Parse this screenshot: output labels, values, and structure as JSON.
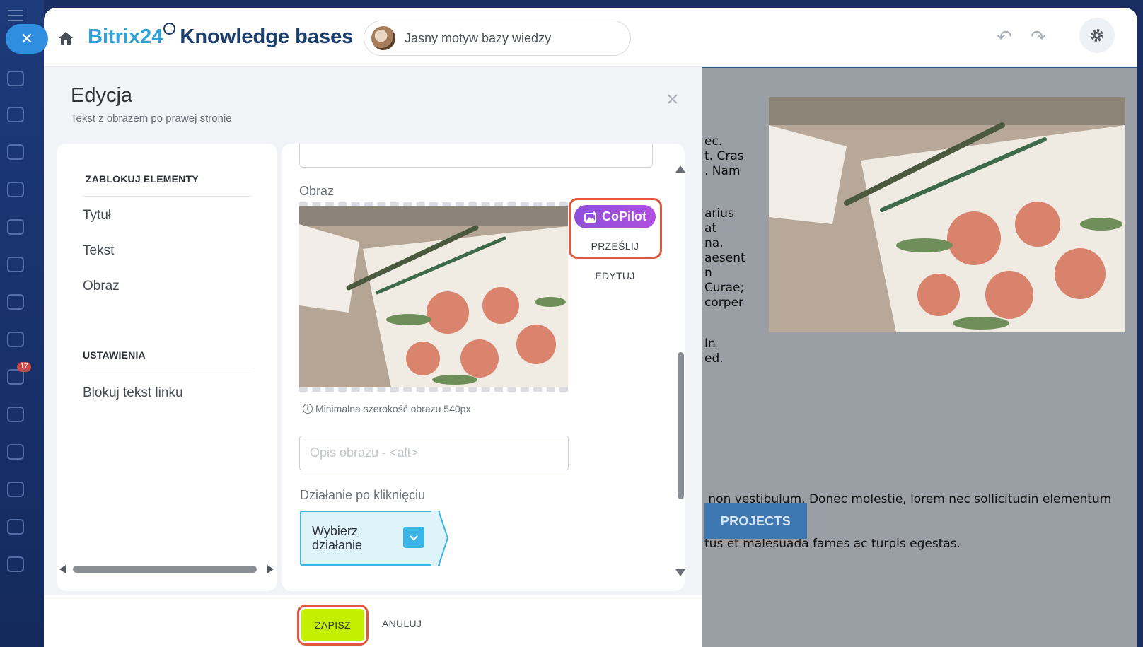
{
  "header": {
    "logo_brand": "Bitrix24",
    "logo_title": "Knowledge bases",
    "theme_name": "Jasny motyw bazy wiedzy"
  },
  "editor": {
    "title": "Edycja",
    "subtitle": "Tekst z obrazem po prawej stronie"
  },
  "nav": {
    "lock_section": "ZABLOKUJ ELEMENTY",
    "lock_items": [
      {
        "label": "Tytuł"
      },
      {
        "label": "Tekst"
      },
      {
        "label": "Obraz"
      }
    ],
    "settings_section": "USTAWIENIA",
    "settings_items": [
      {
        "label": "Blokuj tekst linku"
      }
    ]
  },
  "form": {
    "image_label": "Obraz",
    "copilot_label": "CoPilot",
    "upload_label": "PRZEŚLIJ",
    "edit_label": "EDYTUJ",
    "hint": "Minimalna szerokość obrazu 540px",
    "alt_placeholder": "Opis obrazu - <alt>",
    "alt_value": "",
    "action_label": "Działanie po kliknięciu",
    "action_select_line1": "Wybierz",
    "action_select_line2": "działanie"
  },
  "footer": {
    "save_label": "ZAPISZ",
    "cancel_label": "ANULUJ"
  },
  "preview": {
    "text_lines_a": [
      "ec.",
      "t. Cras",
      ". Nam"
    ],
    "text_lines_b": [
      "arius",
      "at",
      "na.",
      "aesent",
      "n",
      " Curae;",
      "corper"
    ],
    "text_lines_c": [
      "In",
      "ed."
    ],
    "paragraph_line1": " non vestibulum. Donec molestie, lorem nec sollicitudin elementum",
    "paragraph_line2": "tus et malesuada fames ac turpis egestas.",
    "button_label": "PROJECTS"
  },
  "sidebar": {
    "mail_badge": "17"
  },
  "colors": {
    "accent_blue": "#2fa2d8",
    "brand_dark": "#1a3e6e",
    "save_green": "#c4f000",
    "highlight_orange": "#e0593a",
    "copilot_purple": "#8e4fd9"
  }
}
